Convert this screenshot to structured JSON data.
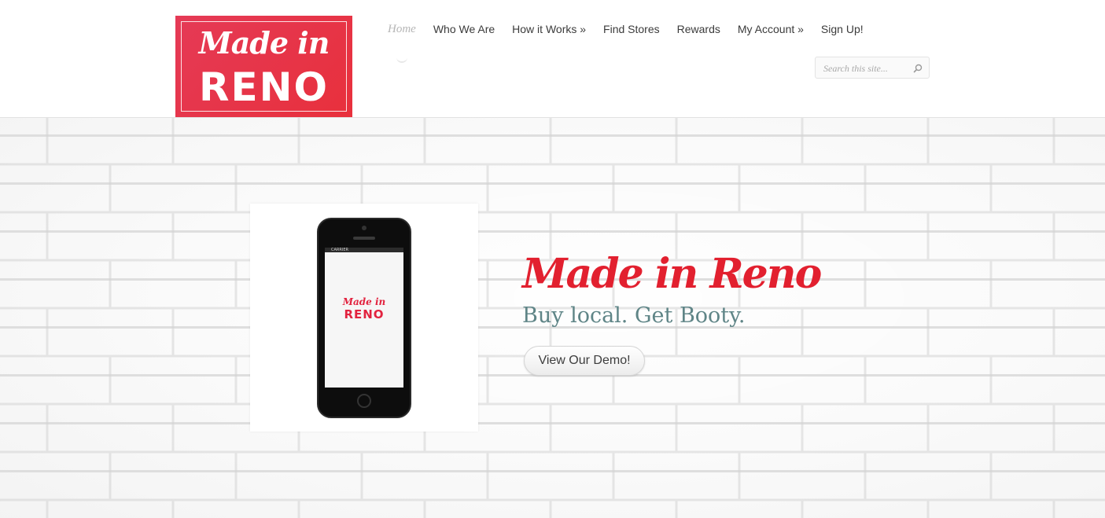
{
  "header": {
    "logo": {
      "script_text": "Made in",
      "main_text": "RENO",
      "color": "#e6354b"
    },
    "nav": {
      "items": [
        {
          "label": "Home",
          "active": true
        },
        {
          "label": "Who We Are",
          "active": false
        },
        {
          "label": "How it Works »",
          "active": false
        },
        {
          "label": "Find Stores",
          "active": false
        },
        {
          "label": "Rewards",
          "active": false
        },
        {
          "label": "My Account »",
          "active": false
        },
        {
          "label": "Sign Up!",
          "active": false
        }
      ]
    },
    "search": {
      "placeholder": "Search this site...",
      "icon": "search-icon"
    }
  },
  "hero": {
    "title": "Made in Reno",
    "subtitle": "Buy local. Get Booty.",
    "cta_label": "View Our Demo!",
    "phone": {
      "status_text": "CARRIER",
      "screen_script": "Made in",
      "screen_main": "RENO"
    },
    "colors": {
      "title": "#e2202f",
      "subtitle": "#5f8587"
    }
  }
}
